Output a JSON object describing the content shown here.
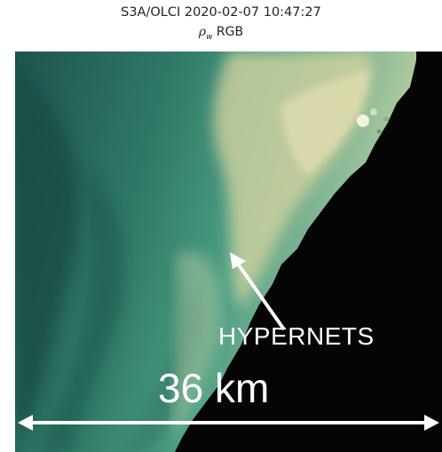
{
  "figure": {
    "title": "S3A/OLCI 2020-02-07 10:47:27",
    "subtitle_symbol": "ρ",
    "subtitle_subscript": "w",
    "subtitle_suffix": " RGB"
  },
  "annotations": {
    "site_label": "HYPERNETS",
    "scale_bar_label": "36 km"
  },
  "colors": {
    "land": "#050505",
    "deep_water": "#1e5b52",
    "mid_water": "#3e8f79",
    "turbid_water": "#c9cf9a",
    "annotation": "#ffffff"
  }
}
